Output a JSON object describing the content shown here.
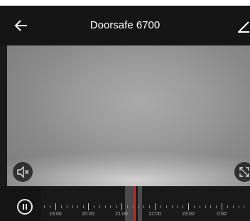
{
  "header": {
    "title": "Doorsafe 6700",
    "back_icon": "arrow-left-icon",
    "edit_icon": "pencil-icon"
  },
  "player": {
    "mute_icon": "speaker-muted-icon",
    "fullscreen_icon": "fullscreen-icon",
    "pause_icon": "pause-icon"
  },
  "timeline": {
    "labels": [
      "19:00",
      "20:00",
      "21:00",
      "22:00",
      "23:00",
      "0:00"
    ]
  },
  "colors": {
    "header_bg": "#151515",
    "timeline_bg": "#191919",
    "cursor": "#d32b2b"
  }
}
